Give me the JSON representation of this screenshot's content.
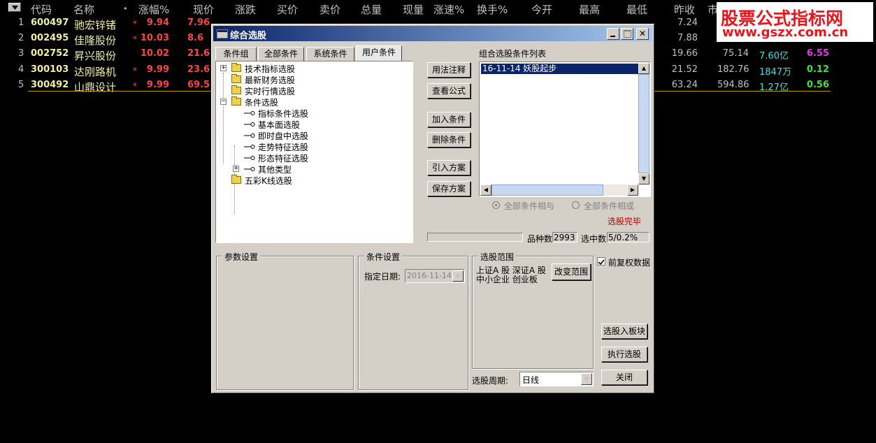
{
  "quote": {
    "headers": [
      "代码",
      "名称",
      "•",
      "涨幅%",
      "现价",
      "涨跌",
      "买价",
      "卖价",
      "总量",
      "现量",
      "涨速%",
      "换手%",
      "今开",
      "最高",
      "最低",
      "昨收",
      "市"
    ],
    "rows": [
      {
        "idx": "1",
        "code": "600497",
        "name": "驰宏锌锗",
        "star": "*",
        "pct": "9.94",
        "price": "7.96",
        "pre": "7.24",
        "val2": "",
        "amt": "",
        "amt_unit": "",
        "rate": "",
        "rate_color": "#ff3cff"
      },
      {
        "idx": "2",
        "code": "002495",
        "name": "佳隆股份",
        "star": "*",
        "pct": "10.03",
        "price": "8.6",
        "pre": "7.88",
        "val2": "",
        "amt": "",
        "amt_unit": "",
        "rate": "",
        "rate_color": "#ff3cff"
      },
      {
        "idx": "3",
        "code": "002752",
        "name": "昇兴股份",
        "star": "",
        "pct": "10.02",
        "price": "21.6",
        "pre": "19.66",
        "val2": "75.14",
        "amt": "7.60",
        "amt_unit": "亿",
        "rate": "6.55",
        "rate_color": "#e040e0"
      },
      {
        "idx": "4",
        "code": "300103",
        "name": "达刚路机",
        "star": "*",
        "pct": "9.99",
        "price": "23.6",
        "pre": "21.52",
        "val2": "182.76",
        "amt": "1847",
        "amt_unit": "万",
        "rate": "0.12",
        "rate_color": "#40e040"
      },
      {
        "idx": "5",
        "code": "300492",
        "name": "山鼎设计",
        "star": "*",
        "pct": "9.99",
        "price": "69.5",
        "pre": "63.24",
        "val2": "594.86",
        "amt": "1.27",
        "amt_unit": "亿",
        "rate": "0.56",
        "rate_color": "#40e040"
      }
    ]
  },
  "watermark": {
    "line1": "股票公式指标网",
    "line2": "www.gszx.com.cn"
  },
  "dialog": {
    "title": "综合选股",
    "tabs": [
      "条件组",
      "全部条件",
      "系统条件",
      "用户条件"
    ],
    "tree": {
      "n0": "技术指标选股",
      "n1": "最新财务选股",
      "n2": "实时行情选股",
      "n3": "条件选股",
      "n4": "指标条件选股",
      "n5": "基本面选股",
      "n6": "即时盘中选股",
      "n7": "走势特征选股",
      "n8": "形态特征选股",
      "n9": "其他类型",
      "n10": "五彩K线选股"
    },
    "buttons": {
      "usage": "用法注释",
      "view_formula": "查看公式",
      "add_cond": "加入条件",
      "del_cond": "删除条件",
      "import_plan": "引入方案",
      "save_plan": "保存方案",
      "change_range": "改变范围",
      "to_block": "选股入板块",
      "run": "执行选股",
      "close": "关闭"
    },
    "cond_list_label": "组合选股条件列表",
    "cond_items": [
      "16-11-14 妖股起步"
    ],
    "radio_and": "全部条件相与",
    "radio_or": "全部条件相或",
    "status": "选股完毕",
    "stock_count_label": "品种数",
    "stock_count": "2993",
    "selected_label": "选中数",
    "selected": "5/0.2%",
    "params_title": "参数设置",
    "cond_settings_title": "条件设置",
    "date_label": "指定日期:",
    "date_value": "2016-11-14",
    "range_title": "选股范围",
    "range_line1": "上证A 股  深证A 股",
    "range_line2": "中小企业  创业板",
    "fq_label": "前复权数据",
    "period_label": "选股周期:",
    "period_value": "日线"
  },
  "colors": {
    "title_start": "#0a246a",
    "title_end": "#a6caf0",
    "status": "#c00000",
    "watermark": "#e8161c"
  }
}
